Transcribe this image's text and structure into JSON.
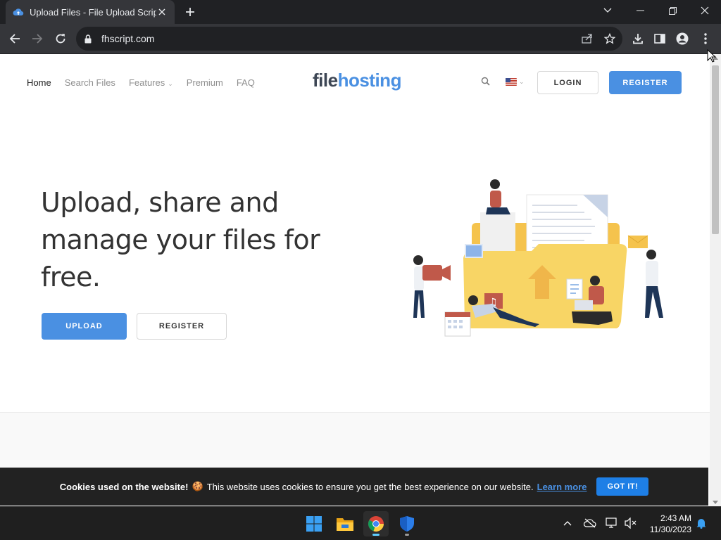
{
  "browser": {
    "tab_title": "Upload Files - File Upload Script",
    "url": "fhscript.com"
  },
  "site": {
    "nav": [
      {
        "label": "Home"
      },
      {
        "label": "Search Files"
      },
      {
        "label": "Features"
      },
      {
        "label": "Premium"
      },
      {
        "label": "FAQ"
      }
    ],
    "logo_part1": "file",
    "logo_part2": "hosting",
    "login_label": "LOGIN",
    "register_label": "REGISTER"
  },
  "hero": {
    "title": "Upload, share and manage your files for free.",
    "upload_label": "UPLOAD",
    "register_label": "REGISTER"
  },
  "cookie_bar": {
    "heading": "Cookies used on the website!",
    "emoji": "🍪",
    "message": "This website uses cookies to ensure you get the best experience on our website.",
    "learn_more": "Learn more",
    "button": "GOT IT!"
  },
  "taskbar": {
    "time": "2:43 AM",
    "date": "11/30/2023",
    "apps": [
      "start-icon",
      "file-explorer-icon",
      "chrome-icon",
      "windows-security-icon"
    ]
  },
  "colors": {
    "accent": "#4a90e2",
    "chrome_dark": "#202124",
    "chrome_toolbar": "#35363a",
    "cookie_bg": "#222222"
  }
}
